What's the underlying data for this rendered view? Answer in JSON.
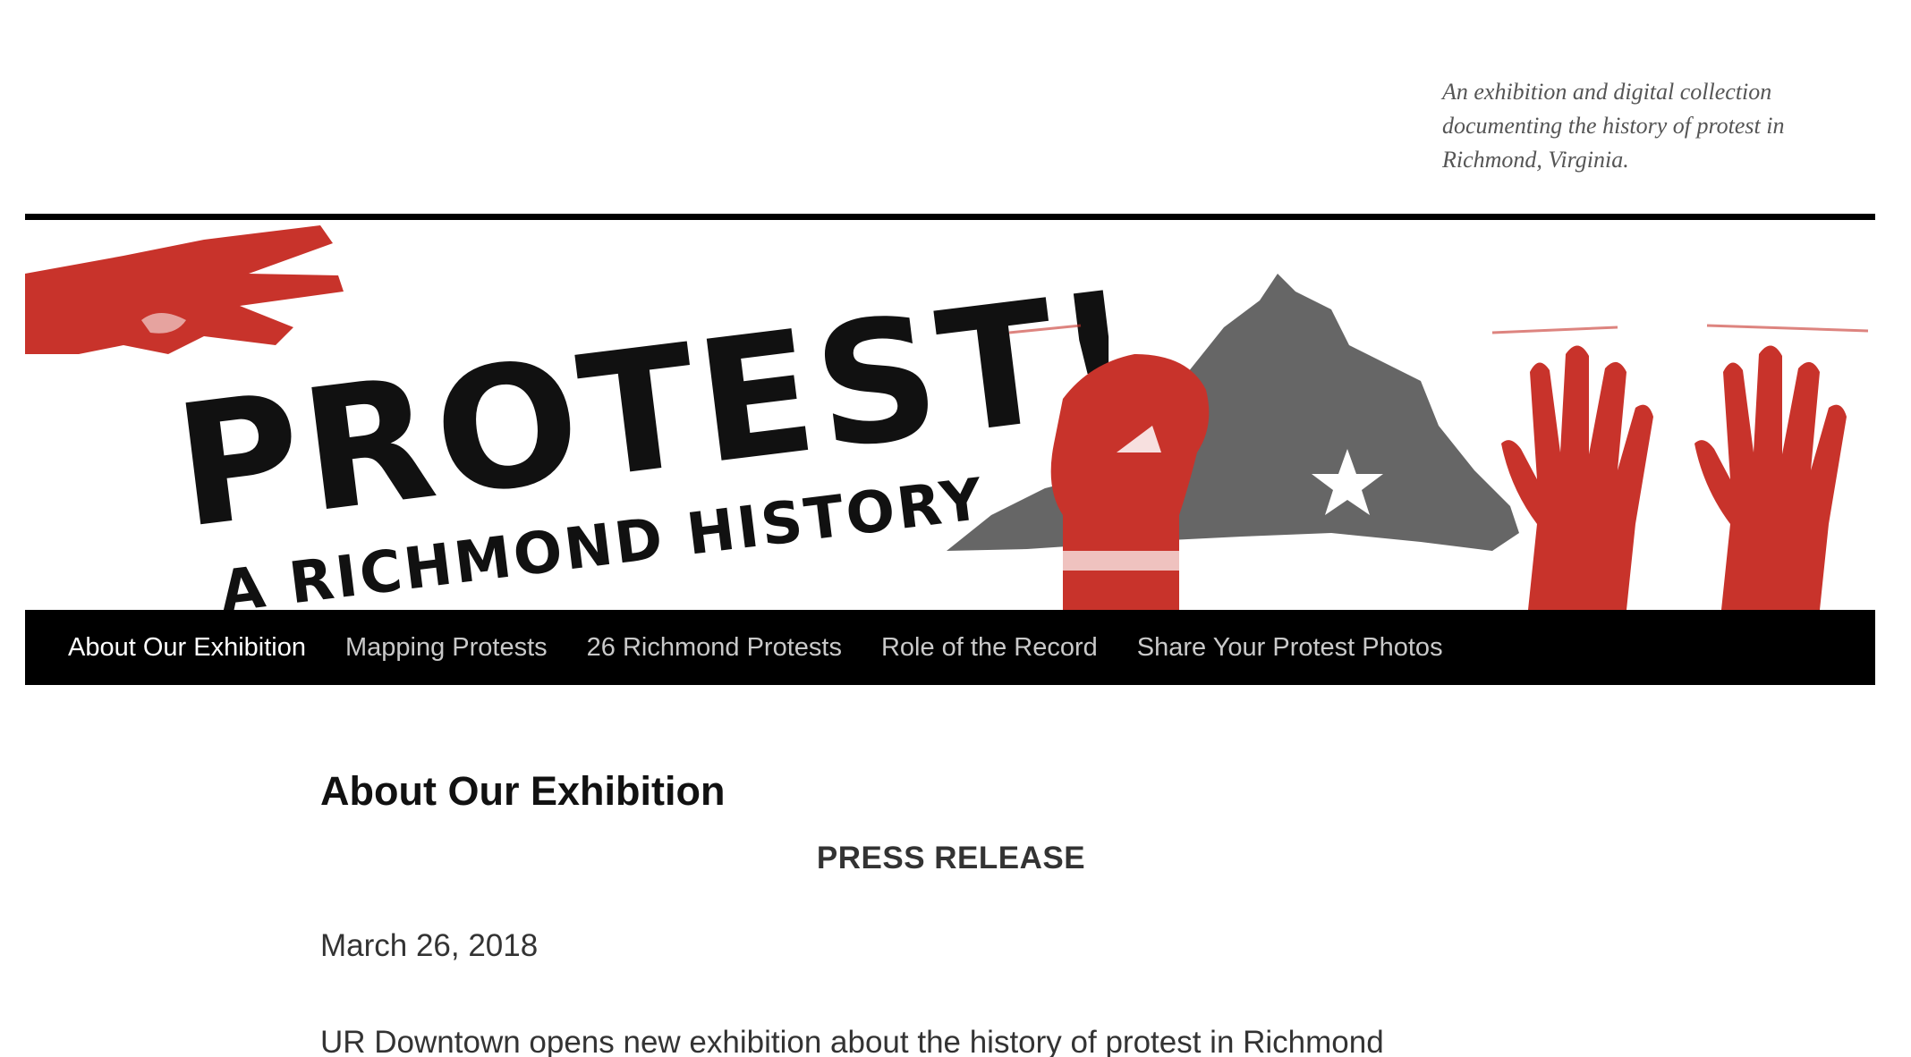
{
  "site": {
    "tagline": "An exhibition and digital collection documenting the history of protest in Richmond, Virginia.",
    "banner": {
      "title": "PROTEST!",
      "subtitle": "A RICHMOND HISTORY"
    }
  },
  "nav": {
    "items": [
      {
        "label": "About Our Exhibition",
        "active": true
      },
      {
        "label": "Mapping Protests",
        "active": false
      },
      {
        "label": "26 Richmond Protests",
        "active": false
      },
      {
        "label": "Role of the Record",
        "active": false
      },
      {
        "label": "Share Your Protest Photos",
        "active": false
      }
    ]
  },
  "main": {
    "title": "About Our Exhibition",
    "press_release_label": "PRESS RELEASE",
    "date": "March 26, 2018",
    "lead": "UR Downtown opens new exhibition about the history of protest in Richmond"
  },
  "colors": {
    "accent_red": "#c8332b",
    "map_gray": "#666666",
    "nav_bg": "#000000"
  }
}
